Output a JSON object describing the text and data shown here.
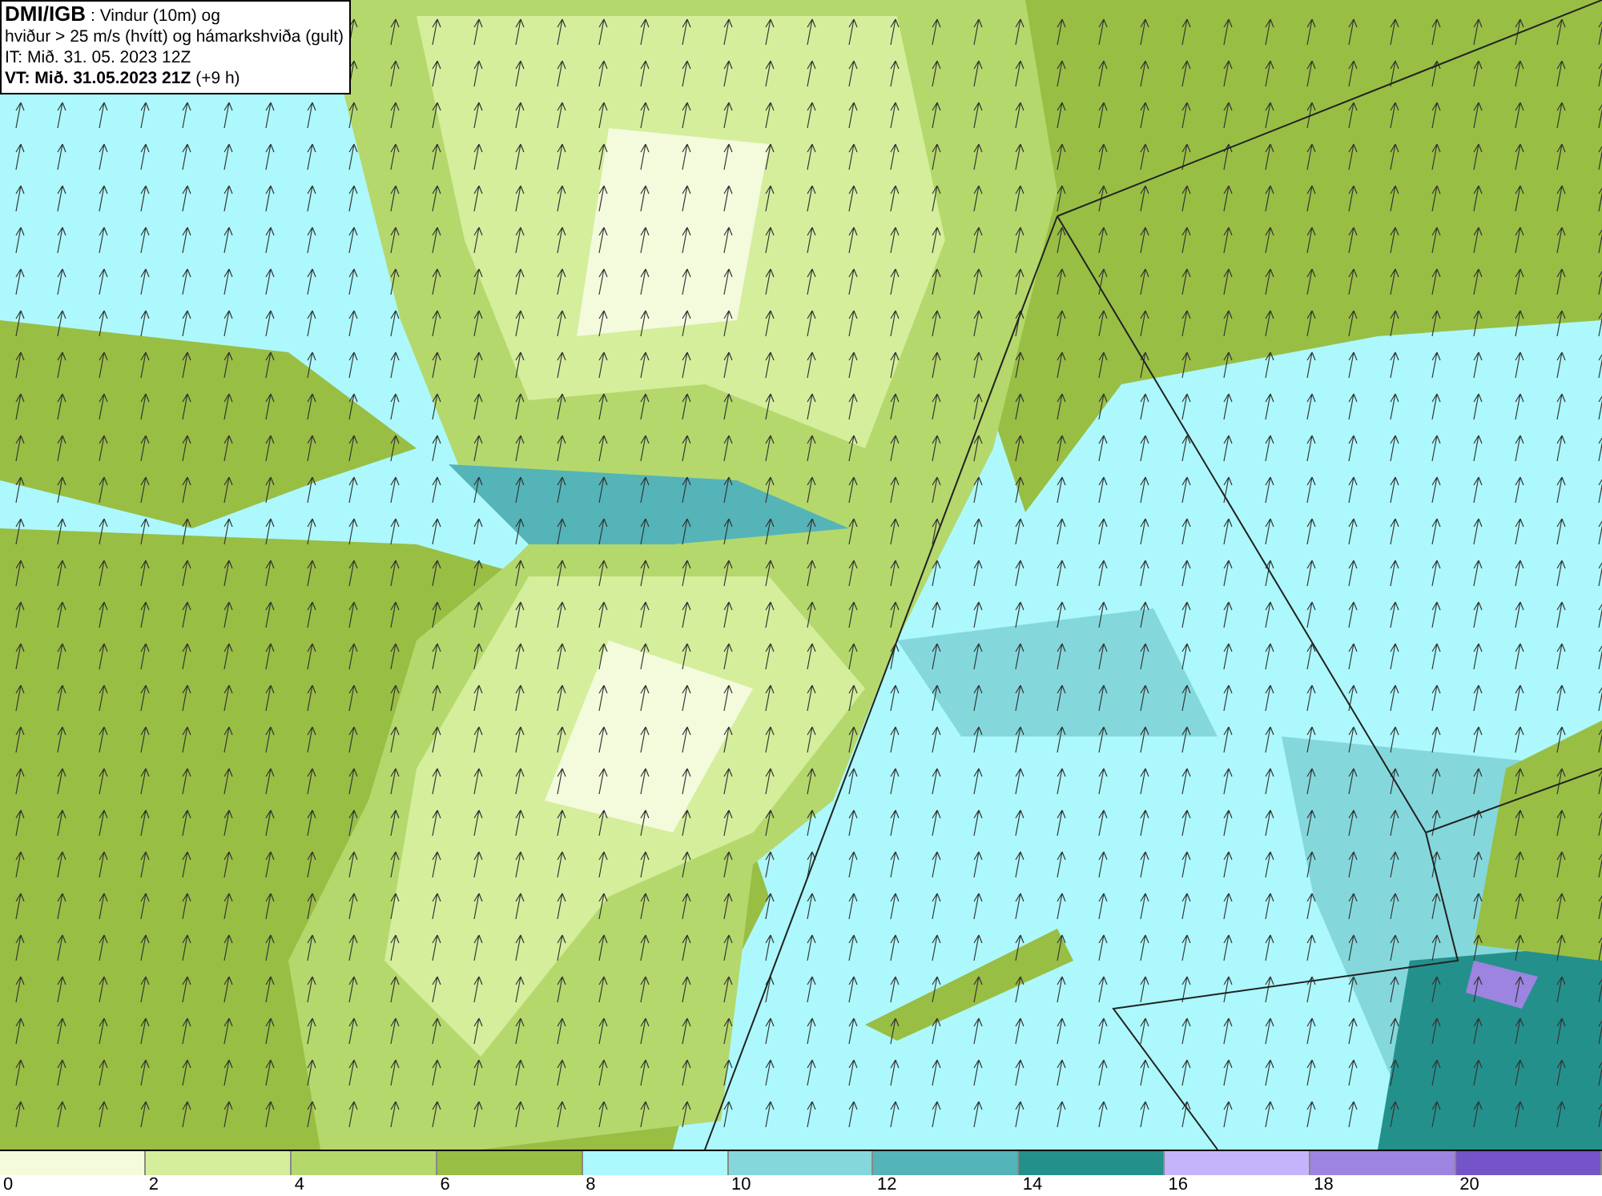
{
  "title_box": {
    "lines": [
      "**DMI/IGB** : Vindur (10m) og",
      "hviður > 25 m/s (hvítt) og hámarkshviða (gult)",
      "IT: Mið. 31. 05. 2023 12Z",
      "**VT: Mið. 31.05.2023 21Z** (+9 h)"
    ]
  },
  "legend": [
    {
      "label": "0",
      "color": "#f4fadc"
    },
    {
      "label": "2",
      "color": "#d4ee9c"
    },
    {
      "label": "4",
      "color": "#b4d86c"
    },
    {
      "label": "6",
      "color": "#98be44"
    },
    {
      "label": "8",
      "color": "#acf8fc"
    },
    {
      "label": "10",
      "color": "#84d8dc"
    },
    {
      "label": "12",
      "color": "#54b4b8"
    },
    {
      "label": "14",
      "color": "#24908c"
    },
    {
      "label": "16",
      "color": "#c4b4fc"
    },
    {
      "label": "18",
      "color": "#9c84e0"
    },
    {
      "label": "20",
      "color": "#7454c8"
    }
  ]
}
